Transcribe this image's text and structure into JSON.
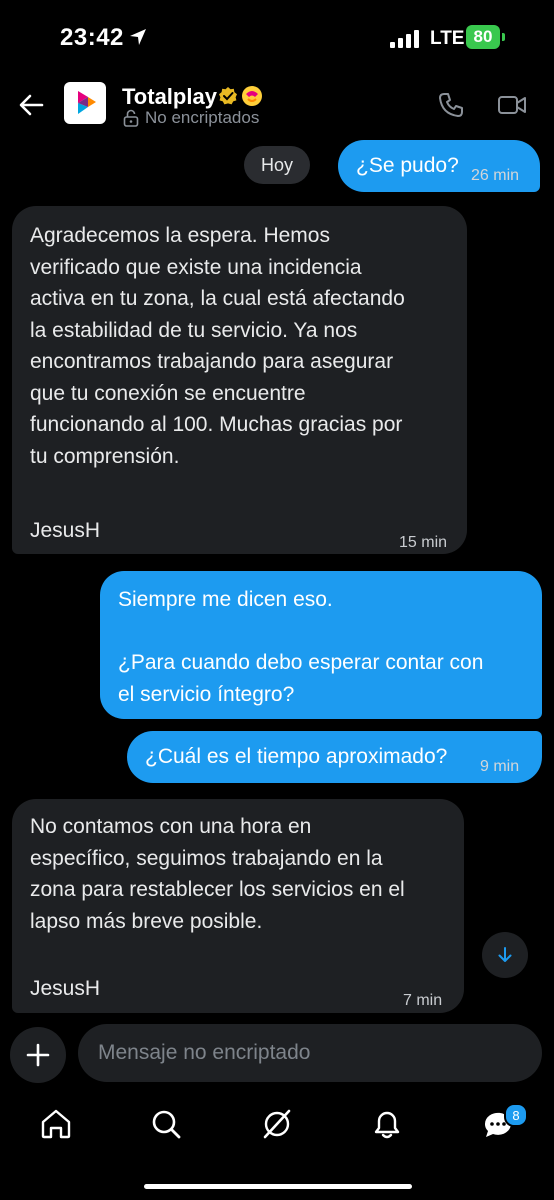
{
  "status_bar": {
    "time": "23:42",
    "network": "LTE",
    "battery": "80"
  },
  "header": {
    "name": "Totalplay",
    "encryption": "No encriptados"
  },
  "messages": {
    "day_label": "Hoy",
    "m1": {
      "text": "¿Se pudo?",
      "time": "26 min"
    },
    "m2": {
      "text": "Agradecemos la espera. Hemos\nverificado que existe una incidencia\nactiva en tu zona, la cual está afectando\nla estabilidad de tu servicio. Ya nos\nencontramos trabajando para asegurar\nque tu conexión se encuentre\nfuncionando al 100. Muchas gracias por\ntu comprensión.",
      "signature": "JesusH",
      "time": "15 min"
    },
    "m3": {
      "text": "Siempre me dicen eso.\n\n¿Para cuando debo esperar contar con\nel servicio íntegro?"
    },
    "m4": {
      "text": "¿Cuál es el tiempo aproximado?",
      "time": "9 min"
    },
    "m5": {
      "text": "No contamos con una hora en\nespecífico, seguimos trabajando en la\nzona para restablecer los servicios en el\nlapso más breve posible.",
      "signature": "JesusH",
      "time": "7 min"
    }
  },
  "composer": {
    "placeholder": "Mensaje no encriptado"
  },
  "tab_bar": {
    "messages_badge": "8"
  },
  "colors": {
    "accent": "#1d9bf0",
    "incoming_bubble": "#1e2023",
    "battery": "#39c84e",
    "secondary_text": "#8b9199"
  }
}
